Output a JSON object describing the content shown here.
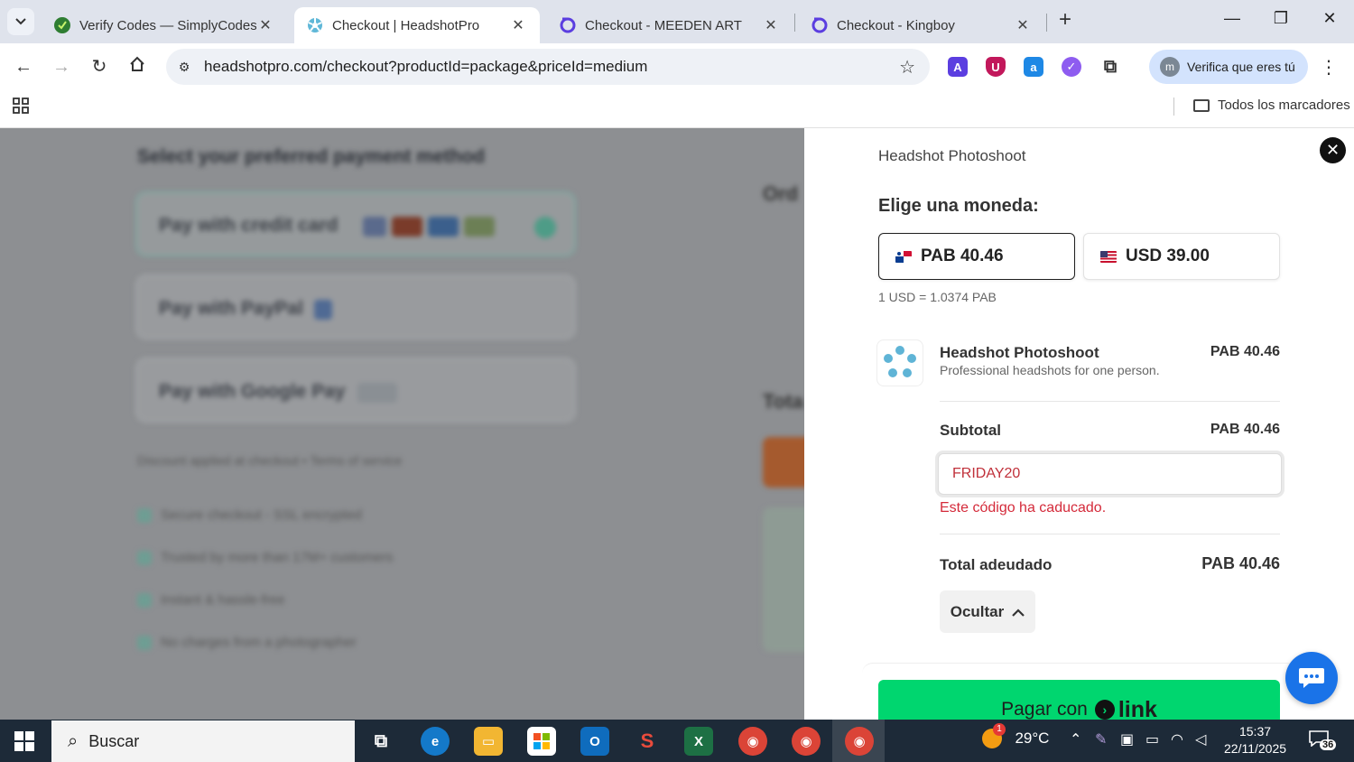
{
  "browser": {
    "tabs": [
      {
        "title": "Verify Codes — SimplyCodes",
        "active": false
      },
      {
        "title": "Checkout | HeadshotPro",
        "active": true
      },
      {
        "title": "Checkout - MEEDEN ART",
        "active": false
      },
      {
        "title": "Checkout - Kingboy",
        "active": false
      }
    ],
    "url": "headshotpro.com/checkout?productId=package&priceId=medium",
    "profile_label": "Verifica que eres tú",
    "profile_initial": "m",
    "all_bookmarks_label": "Todos los marcadores"
  },
  "background": {
    "title": "Select your preferred payment method",
    "payment_options": [
      "Pay with credit card",
      "Pay with PayPal",
      "Pay with Google Pay"
    ],
    "note": "Discount applied at checkout • Terms of service",
    "bullets": [
      "Secure checkout - SSL encrypted",
      "Trusted by more than 17M+ customers",
      "Instant & hassle-free",
      "No charges from a photographer"
    ],
    "right_heading": "Ord",
    "right_total": "Tota"
  },
  "checkout": {
    "product_header": "Headshot Photoshoot",
    "currency_title": "Elige una moneda:",
    "currency_options": [
      {
        "label": "PAB 40.46",
        "selected": true
      },
      {
        "label": "USD 39.00",
        "selected": false
      }
    ],
    "exchange_rate": "1 USD = 1.0374 PAB",
    "item": {
      "name": "Headshot Photoshoot",
      "description": "Professional headshots for one person.",
      "price": "PAB 40.46"
    },
    "subtotal_label": "Subtotal",
    "subtotal_value": "PAB 40.46",
    "promo_code_value": "FRIDAY20",
    "promo_error": "Este código ha caducado.",
    "total_label": "Total adeudado",
    "total_value": "PAB 40.46",
    "hide_label": "Ocultar",
    "pay_button_prefix": "Pagar con",
    "pay_button_brand": "link"
  },
  "taskbar": {
    "search_placeholder": "Buscar",
    "weather": "29°C",
    "weather_badge": "1",
    "time": "15:37",
    "date": "22/11/2025",
    "notifications": "36"
  },
  "colors": {
    "link_green": "#00d66f",
    "error_red": "#d42a3a",
    "chat_blue": "#1a73e8"
  }
}
